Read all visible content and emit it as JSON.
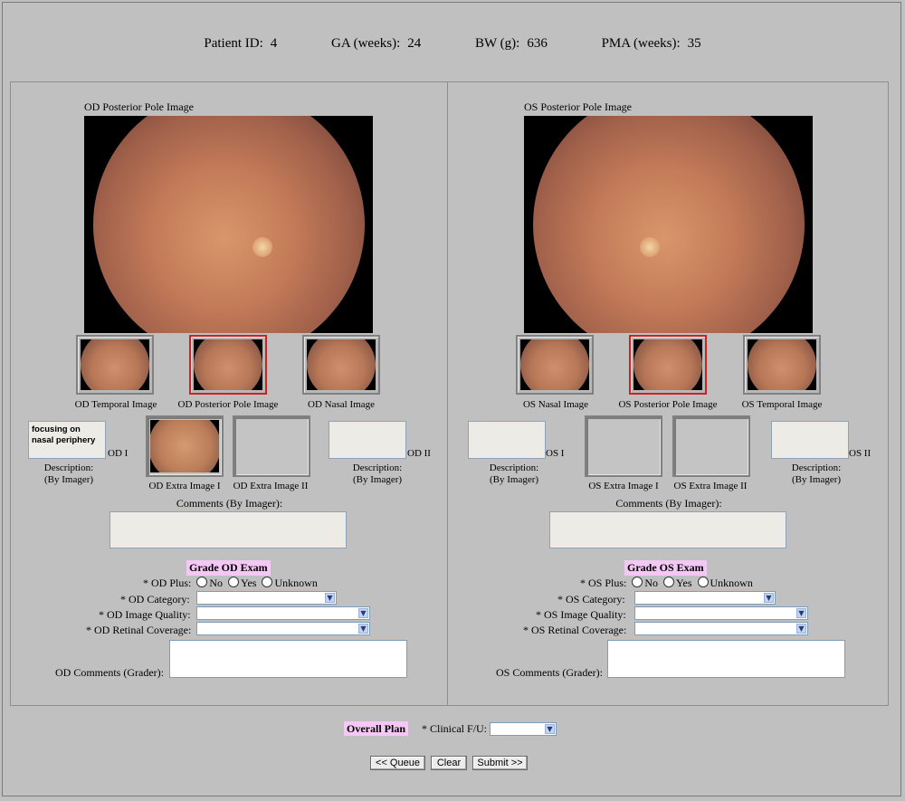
{
  "header": {
    "patient_id_label": "Patient ID:",
    "patient_id": "4",
    "ga_label": "GA (weeks):",
    "ga": "24",
    "bw_label": "BW (g):",
    "bw": "636",
    "pma_label": "PMA (weeks):",
    "pma": "35"
  },
  "od": {
    "posterior_label": "OD Posterior Pole Image",
    "thumbs": [
      "OD Temporal Image",
      "OD Posterior Pole Image",
      "OD Nasal Image"
    ],
    "desc1_text": "focusing on nasal periphery",
    "desc1_tag": "OD I",
    "desc2_tag": "OD II",
    "desc_label": "Description:",
    "desc_sub": "(By Imager)",
    "extra1": "OD Extra Image I",
    "extra2": "OD Extra Image II",
    "comments_label": "Comments (By Imager):",
    "grade_title": "Grade OD Exam",
    "plus_label": "* OD Plus:",
    "category_label": "* OD Category:",
    "quality_label": "* OD Image Quality:",
    "coverage_label": "* OD Retinal Coverage:",
    "grader_comments_label": "OD Comments (Grader):"
  },
  "os": {
    "posterior_label": "OS Posterior Pole Image",
    "thumbs": [
      "OS Nasal Image",
      "OS Posterior Pole Image",
      "OS Temporal Image"
    ],
    "desc1_tag": "OS I",
    "desc2_tag": "OS II",
    "desc_label": "Description:",
    "desc_sub": "(By Imager)",
    "extra1": "OS Extra Image I",
    "extra2": "OS Extra Image II",
    "comments_label": "Comments (By Imager):",
    "grade_title": "Grade OS Exam",
    "plus_label": "* OS Plus:",
    "category_label": "* OS Category:",
    "quality_label": "* OS Image Quality:",
    "coverage_label": "* OS Retinal Coverage:",
    "grader_comments_label": "OS Comments (Grader):"
  },
  "plus_options": [
    "No",
    "Yes",
    "Unknown"
  ],
  "overall": {
    "title": "Overall Plan",
    "fu_label": "* Clinical F/U:"
  },
  "buttons": {
    "queue": "<< Queue",
    "clear": "Clear",
    "submit": "Submit >>"
  }
}
